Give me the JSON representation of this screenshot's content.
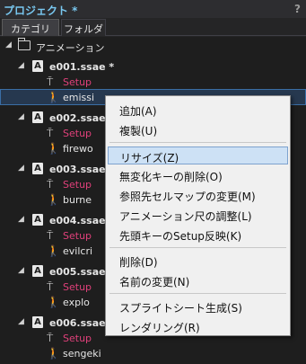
{
  "panel": {
    "title": "プロジェクト *",
    "help": "?"
  },
  "tabs": {
    "category": "カテゴリ",
    "folder": "フォルダ"
  },
  "tree": {
    "root": "アニメーション",
    "animations": [
      {
        "name": "e001.ssae *",
        "items": [
          "Setup",
          "emissi"
        ]
      },
      {
        "name": "e002.ssae",
        "items": [
          "Setup",
          "firewo"
        ]
      },
      {
        "name": "e003.ssae",
        "items": [
          "Setup",
          "burne"
        ]
      },
      {
        "name": "e004.ssae",
        "items": [
          "Setup",
          "evilcri"
        ]
      },
      {
        "name": "e005.ssae",
        "items": [
          "Setup",
          "explo"
        ]
      },
      {
        "name": "e006.ssae",
        "items": [
          "Setup",
          "sengeki"
        ]
      }
    ]
  },
  "context_menu": {
    "items": [
      "追加(A)",
      "複製(U)",
      "リサイズ(Z)",
      "無変化キーの削除(O)",
      "参照先セルマップの変更(M)",
      "アニメーション尺の調整(L)",
      "先頭キーのSetup反映(K)",
      "削除(D)",
      "名前の変更(N)",
      "スプライトシート生成(S)",
      "レンダリング(R)"
    ]
  }
}
